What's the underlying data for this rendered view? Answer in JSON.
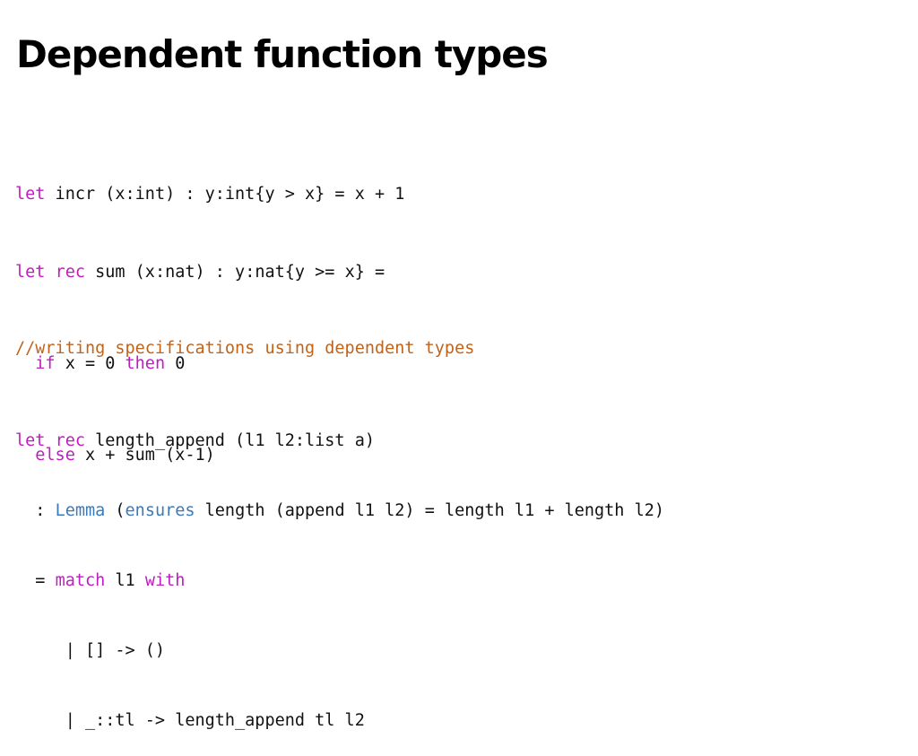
{
  "slide": {
    "title": "Dependent function types"
  },
  "colors": {
    "keyword": "#c21bc2",
    "type_keyword": "#3a7ab8",
    "comment": "#c0631b",
    "text": "#111111"
  },
  "code": {
    "incr": {
      "l1_kw": "let",
      "l1_rest": " incr (x:int) : y:int{y > x} = x + 1"
    },
    "sum": {
      "l1_kw1": "let",
      "l1_sp": " ",
      "l1_kw2": "rec",
      "l1_rest": " sum (x:nat) : y:nat{y >= x} =",
      "l2_indent": "  ",
      "l2_kw1": "if",
      "l2_mid": " x = 0 ",
      "l2_kw2": "then",
      "l2_rest": " 0",
      "l3_indent": "  ",
      "l3_kw": "else",
      "l3_rest": " x + sum (x-1)"
    },
    "comment": "//writing specifications using dependent types",
    "length_append": {
      "l1_kw1": "let",
      "l1_sp": " ",
      "l1_kw2": "rec",
      "l1_rest": " length_append (l1 l2:list a)",
      "l2_pre": "  : ",
      "l2_ty1": "Lemma",
      "l2_mid": " (",
      "l2_ty2": "ensures",
      "l2_rest": " length (append l1 l2) = length l1 + length l2)",
      "l3_pre": "  = ",
      "l3_kw1": "match",
      "l3_mid": " l1 ",
      "l3_kw2": "with",
      "l4": "     | [] -> ()",
      "l5": "     | _::tl -> length_append tl l2"
    }
  }
}
